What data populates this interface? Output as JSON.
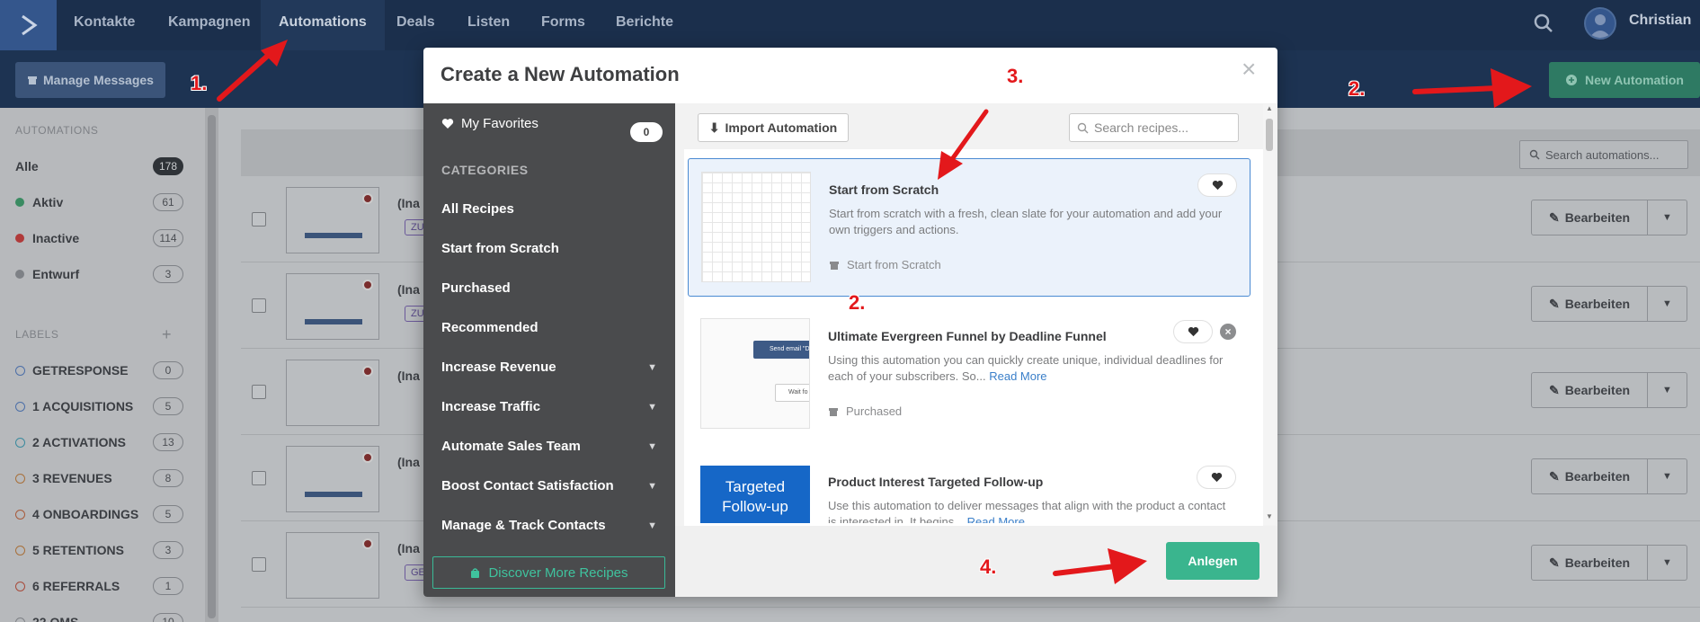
{
  "nav": {
    "items": [
      "Kontakte",
      "Kampagnen",
      "Automations",
      "Deals",
      "Listen",
      "Forms",
      "Berichte"
    ],
    "active_index": 2,
    "user_name": "Christian"
  },
  "toolbar": {
    "manage_messages": "Manage Messages",
    "new_automation": "New Automation",
    "search_placeholder": "Search automations..."
  },
  "sidebar": {
    "automations_title": "AUTOMATIONS",
    "statuses": [
      {
        "label": "Alle",
        "count": "178",
        "color": ""
      },
      {
        "label": "Aktiv",
        "count": "61",
        "color": "#3a8b62"
      },
      {
        "label": "Inactive",
        "count": "114",
        "color": "#b03a3a"
      },
      {
        "label": "Entwurf",
        "count": "3",
        "color": "#7e8186"
      }
    ],
    "labels_title": "LABELS",
    "labels": [
      {
        "label": "GETRESPONSE",
        "count": "0",
        "color": "#4c6fa8"
      },
      {
        "label": "1 ACQUISITIONS",
        "count": "5",
        "color": "#4c6fa8"
      },
      {
        "label": "2 ACTIVATIONS",
        "count": "13",
        "color": "#3a8a9e"
      },
      {
        "label": "3 REVENUES",
        "count": "8",
        "color": "#a8703a"
      },
      {
        "label": "4 ONBOARDINGS",
        "count": "5",
        "color": "#a85a3a"
      },
      {
        "label": "5 RETENTIONS",
        "count": "3",
        "color": "#a8703a"
      },
      {
        "label": "6 REFERRALS",
        "count": "1",
        "color": "#a84a3a"
      },
      {
        "label": "22 OMS",
        "count": "10",
        "color": "#7e8186"
      }
    ]
  },
  "list": {
    "rows": [
      {
        "title": "(Ina",
        "tag": "ZU"
      },
      {
        "title": "(Ina",
        "tag": "ZU"
      },
      {
        "title": "(Ina",
        "tag": ""
      },
      {
        "title": "(Ina",
        "tag": ""
      },
      {
        "title": "(Ina",
        "tag": "GE"
      }
    ],
    "edit_label": "Bearbeiten"
  },
  "modal": {
    "title": "Create a New Automation",
    "favorites_label": "My Favorites",
    "favorites_count": "0",
    "categories_title": "CATEGORIES",
    "categories": [
      {
        "label": "All Recipes",
        "expandable": false
      },
      {
        "label": "Start from Scratch",
        "expandable": false
      },
      {
        "label": "Purchased",
        "expandable": false
      },
      {
        "label": "Recommended",
        "expandable": false
      },
      {
        "label": "Increase Revenue",
        "expandable": true
      },
      {
        "label": "Increase Traffic",
        "expandable": true
      },
      {
        "label": "Automate Sales Team",
        "expandable": true
      },
      {
        "label": "Boost Contact Satisfaction",
        "expandable": true
      },
      {
        "label": "Manage & Track Contacts",
        "expandable": true
      }
    ],
    "discover_label": "Discover More Recipes",
    "import_label": "Import Automation",
    "search_placeholder": "Search recipes...",
    "recipes": [
      {
        "title": "Start from Scratch",
        "desc": "Start from scratch with a fresh, clean slate for your automation and add your own triggers and actions.",
        "more": "",
        "category": "Start from Scratch",
        "selected": true
      },
      {
        "title": "Ultimate Evergreen Funnel by Deadline Funnel",
        "desc": "Using this automation you can quickly create unique, individual deadlines for each of your subscribers. So...",
        "more": "Read More",
        "category": "Purchased",
        "selected": false,
        "thumb_send": "Send email \"Dyn",
        "thumb_wait": "Wait fo"
      },
      {
        "title": "Product Interest Targeted Follow-up",
        "desc": "Use this automation to deliver messages that align with the product a contact is interested in. It begins...",
        "more": "Read More",
        "category": "",
        "selected": false,
        "thumb_text": "Targeted Follow-up"
      }
    ],
    "create_label": "Anlegen"
  },
  "annotations": [
    "1.",
    "2.",
    "3.",
    "2.",
    "4."
  ],
  "colors": {
    "nav_bg": "#1b2f4c",
    "accent_green": "#3ab58e",
    "link_blue": "#3a7fc9",
    "annotation_red": "#e3181b"
  }
}
